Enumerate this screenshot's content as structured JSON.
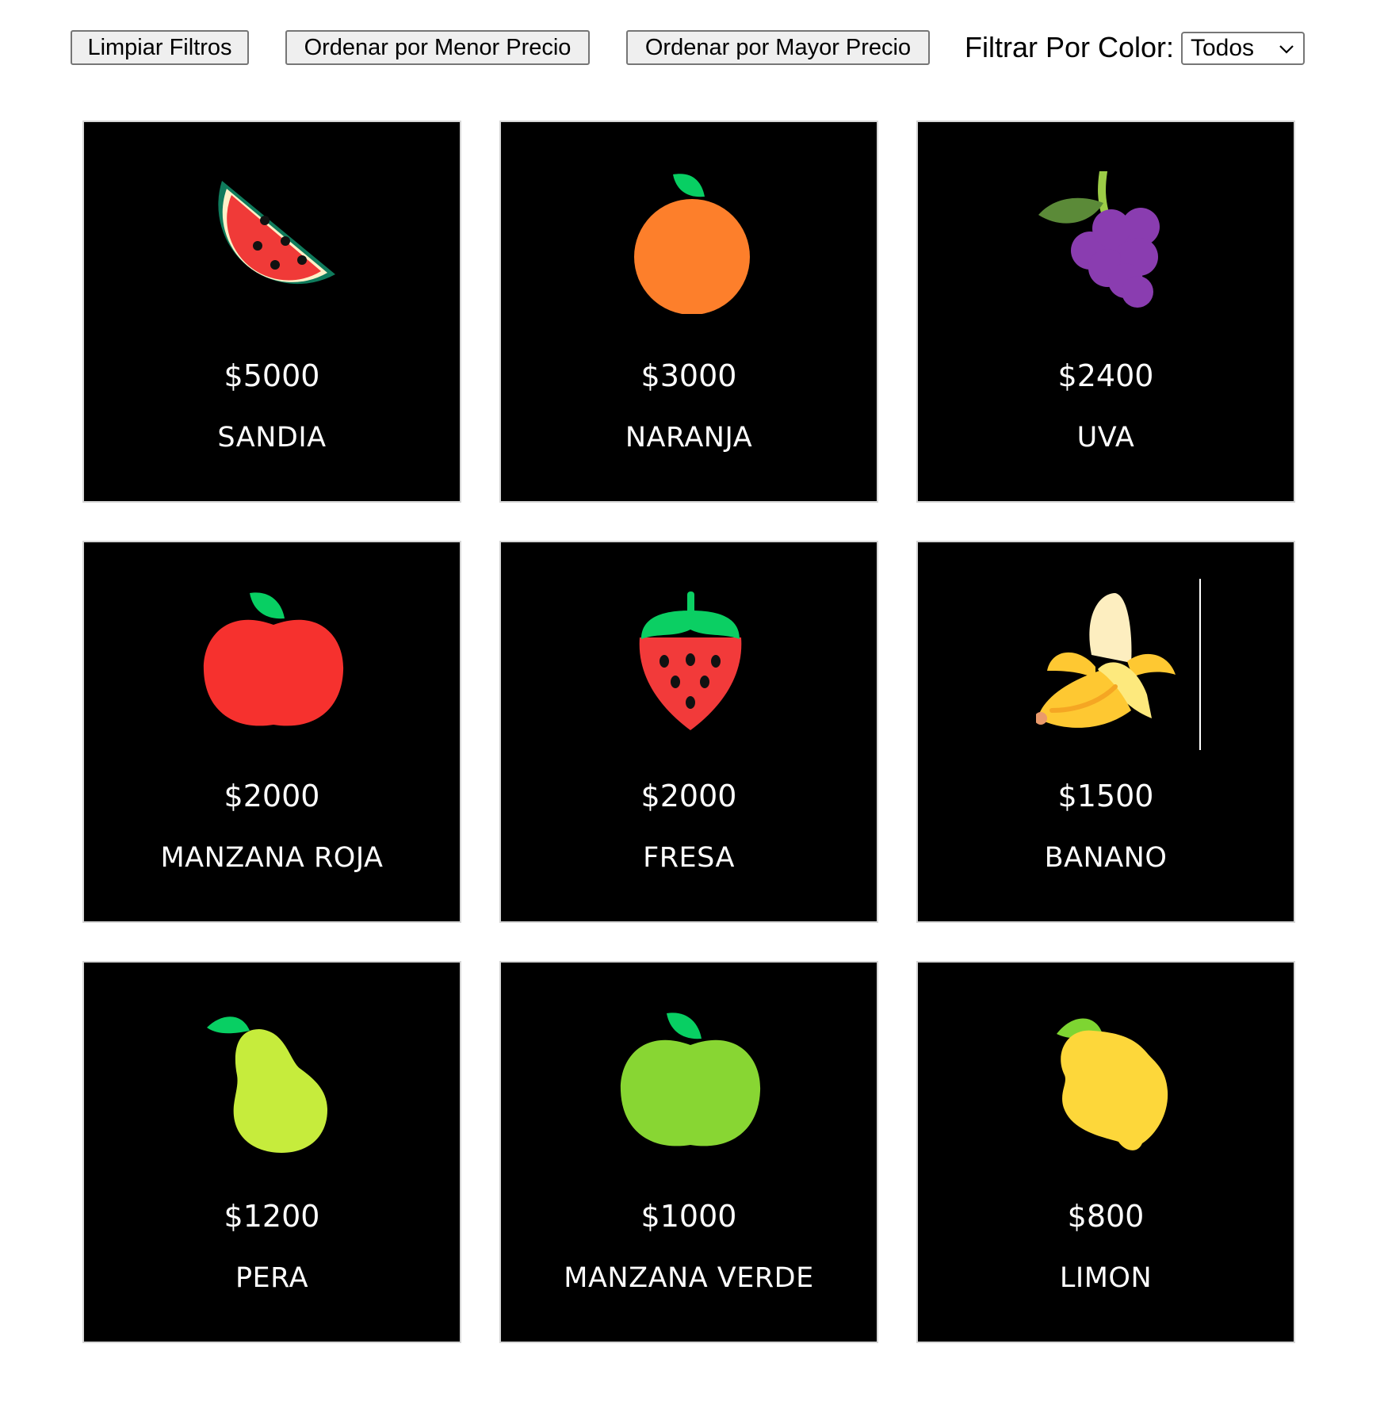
{
  "toolbar": {
    "clear_label": "Limpiar Filtros",
    "sort_asc_label": "Ordenar por Menor Precio",
    "sort_desc_label": "Ordenar por Mayor Precio",
    "filter_label": "Filtrar Por Color:",
    "filter_selected": "Todos"
  },
  "products": [
    {
      "price": "$5000",
      "name": "SANDIA",
      "icon": "watermelon-icon"
    },
    {
      "price": "$3000",
      "name": "NARANJA",
      "icon": "orange-icon"
    },
    {
      "price": "$2400",
      "name": "UVA",
      "icon": "grapes-icon"
    },
    {
      "price": "$2000",
      "name": "MANZANA ROJA",
      "icon": "red-apple-icon"
    },
    {
      "price": "$2000",
      "name": "FRESA",
      "icon": "strawberry-icon"
    },
    {
      "price": "$1500",
      "name": "BANANO",
      "icon": "banana-icon"
    },
    {
      "price": "$1200",
      "name": "PERA",
      "icon": "pear-icon"
    },
    {
      "price": "$1000",
      "name": "MANZANA VERDE",
      "icon": "green-apple-icon"
    },
    {
      "price": "$800",
      "name": "LIMON",
      "icon": "lemon-icon"
    }
  ]
}
